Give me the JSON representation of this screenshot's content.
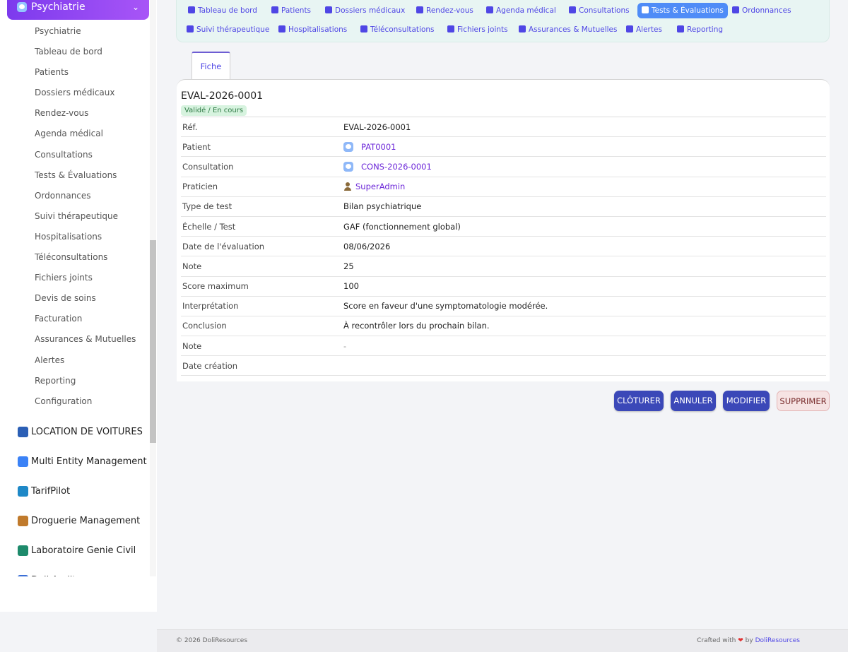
{
  "sidebar": {
    "module_title": "Psychiatrie",
    "items": [
      "Psychiatrie",
      "Tableau de bord",
      "Patients",
      "Dossiers médicaux",
      "Rendez-vous",
      "Agenda médical",
      "Consultations",
      "Tests & Évaluations",
      "Ordonnances",
      "Suivi thérapeutique",
      "Hospitalisations",
      "Téléconsultations",
      "Fichiers joints",
      "Devis de soins",
      "Facturation",
      "Assurances & Mutuelles",
      "Alertes",
      "Reporting",
      "Configuration"
    ],
    "other_modules": [
      {
        "label": "LOCATION DE VOITURES",
        "color": "#2b5fb5"
      },
      {
        "label": "Multi Entity Management",
        "color": "#3b82f6"
      },
      {
        "label": "TarifPilot",
        "color": "#1e88c7"
      },
      {
        "label": "Droguerie Management",
        "color": "#c07a2c"
      },
      {
        "label": "Laboratoire Genie Civil",
        "color": "#1d8a6b"
      },
      {
        "label": "Doli Audit",
        "color": "#3b6fd6"
      }
    ]
  },
  "topnav": {
    "items": [
      {
        "label": "Tableau de bord",
        "icon": "dashboard-icon"
      },
      {
        "label": "Patients",
        "icon": "user-icon"
      },
      {
        "label": "Dossiers médicaux",
        "icon": "folder-icon"
      },
      {
        "label": "Rendez-vous",
        "icon": "calendar-check-icon"
      },
      {
        "label": "Agenda médical",
        "icon": "calendar-icon"
      },
      {
        "label": "Consultations",
        "icon": "stethoscope-icon"
      },
      {
        "label": "Tests & Évaluations",
        "icon": "clipboard-icon",
        "active": true
      },
      {
        "label": "Ordonnances",
        "icon": "prescription-icon"
      },
      {
        "label": "Suivi thérapeutique",
        "icon": "notes-icon"
      },
      {
        "label": "Hospitalisations",
        "icon": "bed-icon"
      },
      {
        "label": "Téléconsultations",
        "icon": "video-icon"
      },
      {
        "label": "Fichiers joints",
        "icon": "file-icon"
      },
      {
        "label": "Assurances & Mutuelles",
        "icon": "shield-icon"
      },
      {
        "label": "Alertes",
        "icon": "warning-icon"
      },
      {
        "label": "Reporting",
        "icon": "chart-pie-icon"
      }
    ]
  },
  "tab": {
    "label": "Fiche"
  },
  "record": {
    "ref": "EVAL-2026-0001",
    "status": "Validé / En cours",
    "fields": [
      {
        "label": "Réf.",
        "value": "EVAL-2026-0001"
      },
      {
        "label": "Patient",
        "value": "PAT0001",
        "link": true,
        "icon": "object-icon"
      },
      {
        "label": "Consultation",
        "value": "CONS-2026-0001",
        "link": true,
        "icon": "object-icon"
      },
      {
        "label": "Praticien",
        "value": "SuperAdmin",
        "link": true,
        "icon": "user-icon"
      },
      {
        "label": "Type de test",
        "value": "Bilan psychiatrique"
      },
      {
        "label": "Échelle / Test",
        "value": "GAF (fonctionnement global)"
      },
      {
        "label": "Date de l'évaluation",
        "value": "08/06/2026"
      },
      {
        "label": "Note",
        "value": "25"
      },
      {
        "label": "Score maximum",
        "value": "100"
      },
      {
        "label": "Interprétation",
        "value": "Score en faveur d'une symptomatologie modérée."
      },
      {
        "label": "Conclusion",
        "value": "À recontrôler lors du prochain bilan."
      },
      {
        "label": "Note",
        "value": "-",
        "dash": true
      },
      {
        "label": "Date création",
        "value": ""
      }
    ]
  },
  "actions": {
    "close": "CLÔTURER",
    "cancel": "ANNULER",
    "edit": "MODIFIER",
    "delete": "SUPPRIMER"
  },
  "footer": {
    "copyright": "© 2026 DoliResources",
    "crafted_prefix": "Crafted with",
    "crafted_by": "by",
    "brand": "DoliResources"
  },
  "colors": {
    "accent": "#4f46e5",
    "primary_button": "#3b48b8",
    "active_nav": "#4f8cf7",
    "status_bg": "#d7f3df"
  }
}
